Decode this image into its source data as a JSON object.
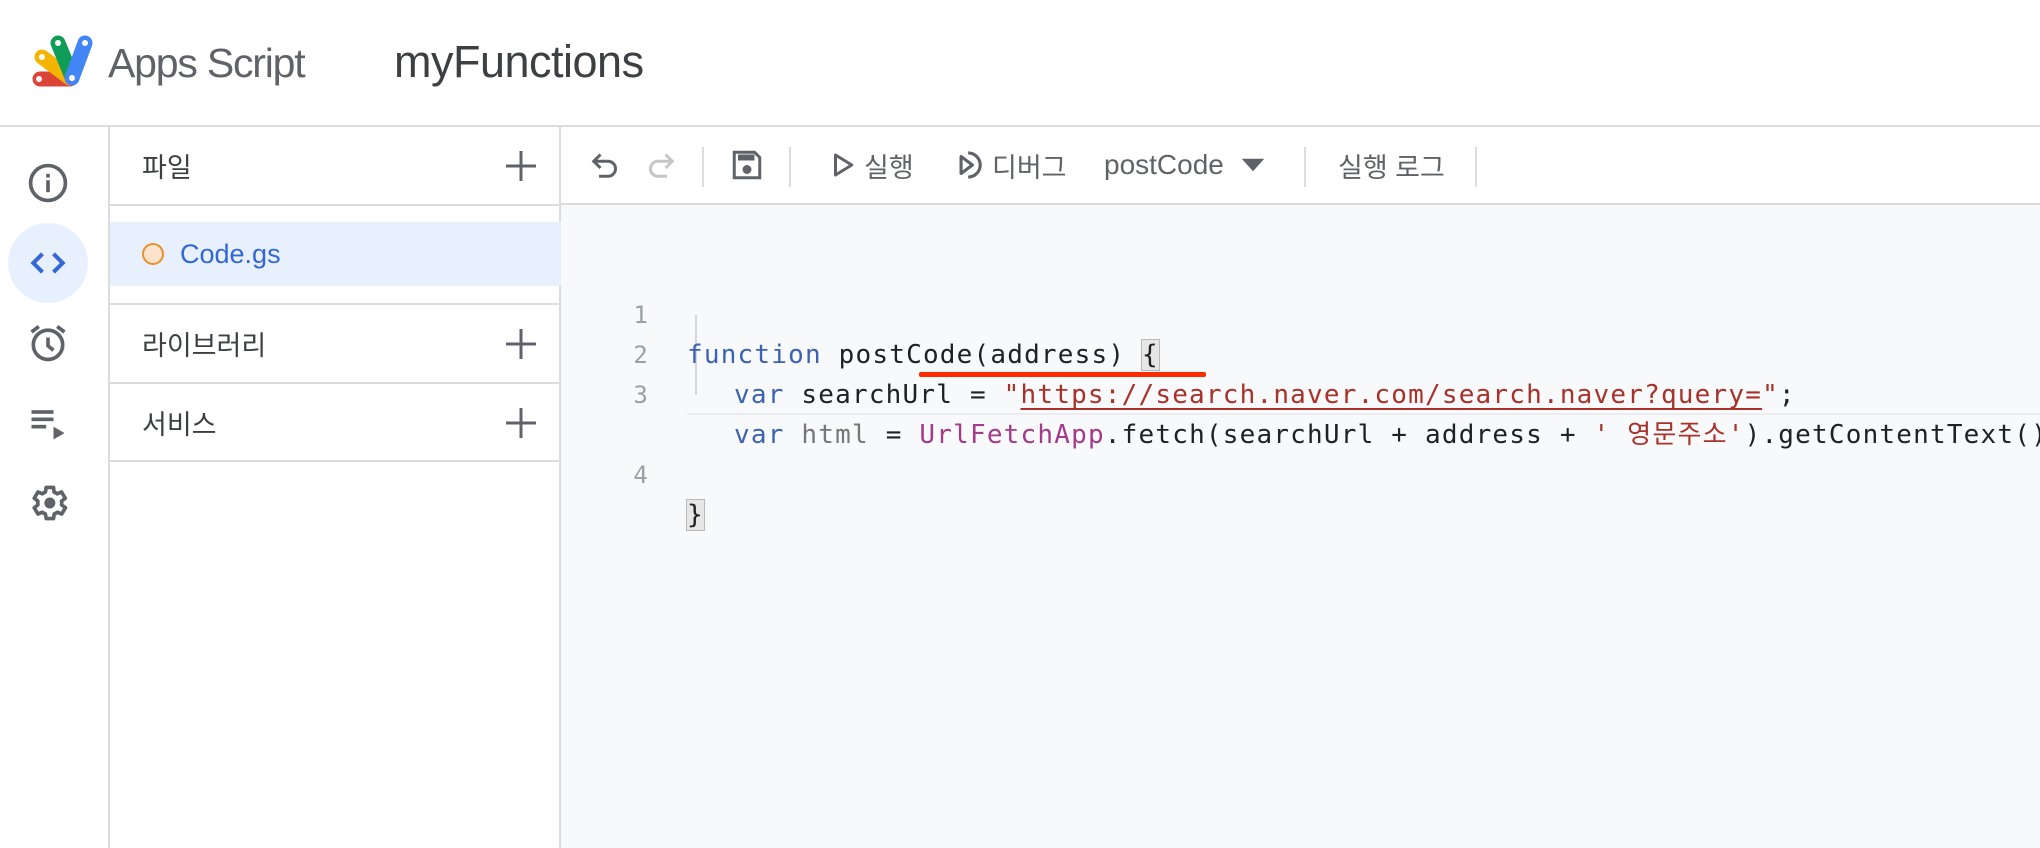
{
  "header": {
    "product_name": "Apps Script",
    "project_title": "myFunctions",
    "logo_icon": "apps-script-logo",
    "logo_colors": [
      "#db4437",
      "#f4b400",
      "#0f9d58",
      "#4285f4"
    ]
  },
  "rail": {
    "items": [
      {
        "name": "overview",
        "icon": "info-icon",
        "active": false
      },
      {
        "name": "editor",
        "icon": "code-icon",
        "active": true
      },
      {
        "name": "triggers",
        "icon": "alarm-clock-icon",
        "active": false
      },
      {
        "name": "executions",
        "icon": "executions-icon",
        "active": false
      },
      {
        "name": "settings",
        "icon": "gear-icon",
        "active": false
      }
    ]
  },
  "files_panel": {
    "files_label": "파일",
    "files": [
      {
        "name": "Code.gs",
        "status_color": "#e8912d",
        "selected": true
      }
    ],
    "libraries_label": "라이브러리",
    "services_label": "서비스",
    "add_icon": "plus-icon"
  },
  "toolbar": {
    "undo_icon": "undo-icon",
    "redo_icon": "redo-icon",
    "save_icon": "save-icon",
    "run_label": "실행",
    "debug_label": "디버그",
    "function_select_value": "postCode",
    "execution_log_label": "실행 로그"
  },
  "editor": {
    "line_numbers": [
      "1",
      "2",
      "3",
      "4"
    ],
    "lines": [
      {
        "tokens": [
          [
            "kw",
            "function"
          ],
          [
            "plain",
            " postCode(address) "
          ],
          [
            "bracket",
            "{"
          ]
        ]
      },
      {
        "tokens": [
          [
            "kw",
            "var"
          ],
          [
            "plain",
            " searchUrl = "
          ],
          [
            "str",
            "\""
          ],
          [
            "url",
            "https://search.naver.com/search.naver?query="
          ],
          [
            "str",
            "\""
          ],
          [
            "plain",
            ";"
          ]
        ]
      },
      {
        "tokens": [
          [
            "kw",
            "var"
          ],
          [
            "plain",
            " "
          ],
          [
            "grey",
            "html"
          ],
          [
            "plain",
            " = "
          ],
          [
            "cls",
            "UrlFetchApp"
          ],
          [
            "plain",
            ".fetch(searchUrl + address + "
          ],
          [
            "str",
            "' 영문주소'"
          ],
          [
            "plain",
            ").getContentText();"
          ]
        ]
      },
      {
        "tokens": [
          [
            "bracket",
            "}"
          ]
        ]
      }
    ],
    "annotation_color": "#ff2a00",
    "annotated_text": "UrlFetchApp.fetch"
  },
  "colors": {
    "accent": "#3367d6",
    "selected_bg": "#e8f0fe",
    "editor_bg": "#f8f9fa",
    "keyword": "#3c62b3",
    "string": "#a8312a",
    "class": "#a33a8a"
  }
}
